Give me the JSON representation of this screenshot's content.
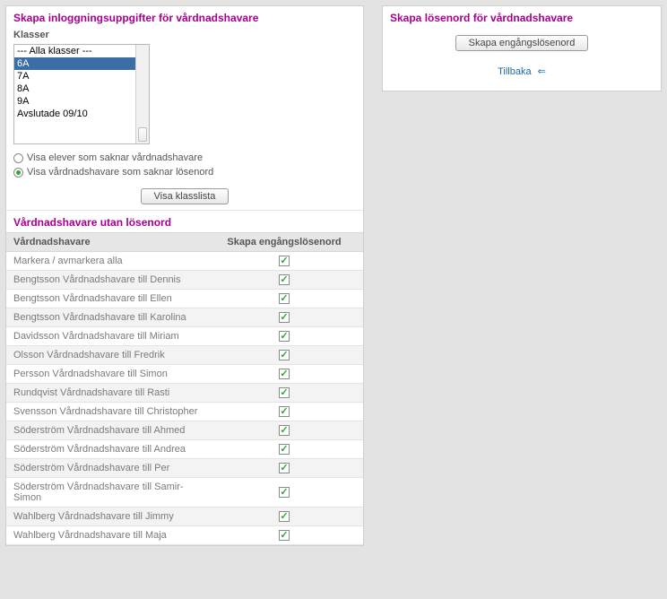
{
  "left": {
    "title": "Skapa inloggningsuppgifter för vårdnadshavare",
    "klasser_label": "Klasser",
    "klasser": {
      "options": [
        "--- Alla klasser ---",
        "6A",
        "7A",
        "8A",
        "9A",
        "Avslutade 09/10"
      ],
      "selected_index": 1
    },
    "radios": {
      "opt1": "Visa elever som saknar vårdnadshavare",
      "opt2": "Visa vårdnadshavare som saknar lösenord",
      "selected": "opt2"
    },
    "show_button": "Visa klasslista",
    "subheader": "Vårdnadshavare utan lösenord",
    "table": {
      "col_guardian": "Vårdnadshavare",
      "col_password": "Skapa engångslösenord",
      "rows": [
        {
          "name": "Markera / avmarkera alla",
          "checked": true
        },
        {
          "name": "Bengtsson Vårdnadshavare till Dennis",
          "checked": true
        },
        {
          "name": "Bengtsson Vårdnadshavare till Ellen",
          "checked": true
        },
        {
          "name": "Bengtsson Vårdnadshavare till Karolina",
          "checked": true
        },
        {
          "name": "Davidsson Vårdnadshavare till Miriam",
          "checked": true
        },
        {
          "name": "Olsson Vårdnadshavare till Fredrik",
          "checked": true
        },
        {
          "name": "Persson Vårdnadshavare till Simon",
          "checked": true
        },
        {
          "name": "Rundqvist Vårdnadshavare till Rasti",
          "checked": true
        },
        {
          "name": "Svensson Vårdnadshavare till Christopher",
          "checked": true
        },
        {
          "name": "Söderström Vårdnadshavare till Ahmed",
          "checked": true
        },
        {
          "name": "Söderström Vårdnadshavare till Andrea",
          "checked": true
        },
        {
          "name": "Söderström Vårdnadshavare till Per",
          "checked": true
        },
        {
          "name": "Söderström Vårdnadshavare till Samir-Simon",
          "checked": true
        },
        {
          "name": "Wahlberg Vårdnadshavare till Jimmy",
          "checked": true
        },
        {
          "name": "Wahlberg Vårdnadshavare till Maja",
          "checked": true
        }
      ]
    }
  },
  "right": {
    "title": "Skapa lösenord för vårdnadshavare",
    "create_button": "Skapa engångslösenord",
    "back_link": "Tillbaka"
  }
}
